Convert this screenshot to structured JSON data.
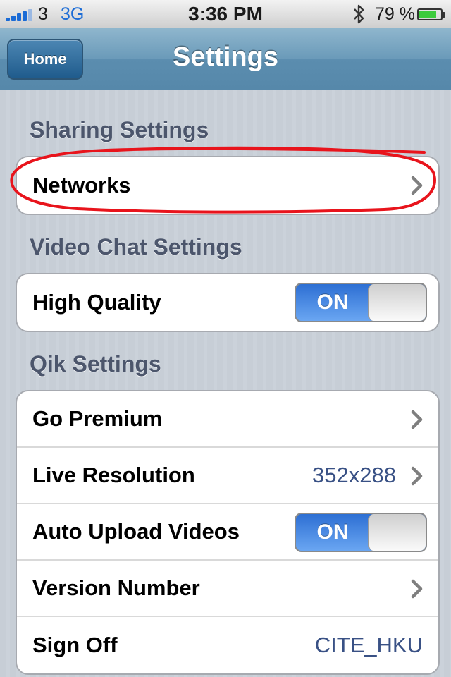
{
  "status_bar": {
    "carrier": "3",
    "network_type": "3G",
    "time": "3:36 PM",
    "battery_percent_label": "79 %",
    "battery_level": 0.79,
    "icons": [
      "signal-bars-icon",
      "bluetooth-icon",
      "battery-icon"
    ]
  },
  "nav": {
    "home_label": "Home",
    "title": "Settings"
  },
  "sections": {
    "sharing": {
      "header": "Sharing Settings",
      "networks_label": "Networks"
    },
    "video_chat": {
      "header": "Video Chat Settings",
      "high_quality_label": "High Quality",
      "high_quality_toggle": "ON"
    },
    "qik": {
      "header": "Qik Settings",
      "go_premium_label": "Go Premium",
      "live_resolution_label": "Live Resolution",
      "live_resolution_value": "352x288",
      "auto_upload_label": "Auto Upload Videos",
      "auto_upload_toggle": "ON",
      "version_number_label": "Version Number",
      "sign_off_label": "Sign Off",
      "sign_off_value": "CITE_HKU"
    }
  },
  "colors": {
    "accent_blue": "#1a6bd6",
    "nav_bar": "#6a9ab9",
    "annotation_red": "#e8141c",
    "value_text": "#395185"
  }
}
